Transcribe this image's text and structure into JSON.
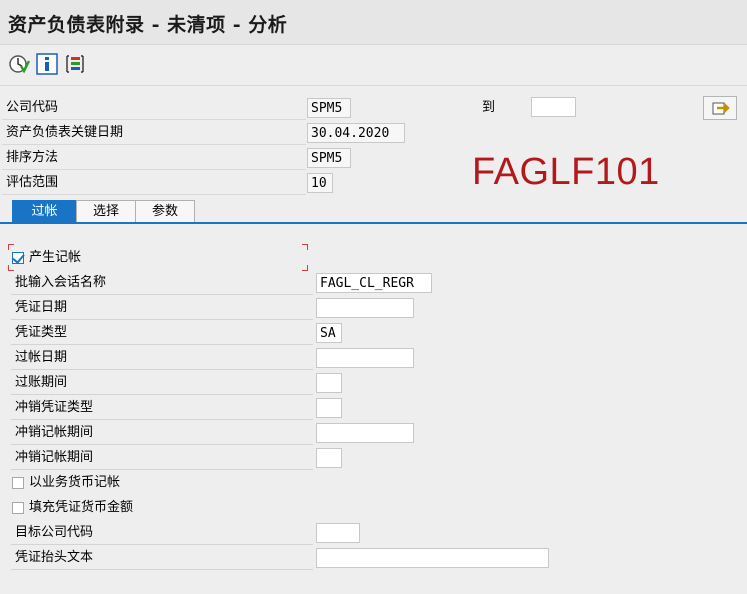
{
  "window": {
    "title": "资产负债表附录 - 未清项 - 分析"
  },
  "toolbar": {
    "execute_icon": "execute-clock-icon",
    "info_icon": "info-icon",
    "variant_icon": "program-variant-icon"
  },
  "header_fields": {
    "company_code_label": "公司代码",
    "company_code_value": "SPM5",
    "to_label": "到",
    "to_value": "",
    "key_date_label": "资产负债表关键日期",
    "key_date_value": "30.04.2020",
    "sort_method_label": "排序方法",
    "sort_method_value": "SPM5",
    "valuation_area_label": "评估范围",
    "valuation_area_value": "10"
  },
  "transaction_code": "FAGLF101",
  "tabs": [
    {
      "label": "过帐",
      "active": true
    },
    {
      "label": "选择",
      "active": false
    },
    {
      "label": "参数",
      "active": false
    }
  ],
  "posting": {
    "generate_postings_label": "产生记帐",
    "generate_postings_checked": true,
    "session_name_label": "批输入会话名称",
    "session_name_value": "FAGL_CL_REGR",
    "doc_date_label": "凭证日期",
    "doc_date_value": "",
    "doc_type_label": "凭证类型",
    "doc_type_value": "SA",
    "posting_date_label": "过帐日期",
    "posting_date_value": "",
    "posting_period_label": "过账期间",
    "posting_period_value": "",
    "reversal_doc_type_label": "冲销凭证类型",
    "reversal_doc_type_value": "",
    "reversal_posting_date_label": "冲销记帐期间",
    "reversal_posting_date_value": "",
    "reversal_posting_period_label": "冲销记帐期间",
    "reversal_posting_period_value": "",
    "tx_currency_label": "以业务货币记帐",
    "tx_currency_checked": false,
    "fill_doc_amount_label": "填充凭证货币金额",
    "fill_doc_amount_checked": false,
    "target_company_label": "目标公司代码",
    "target_company_value": "",
    "header_text_label": "凭证抬头文本",
    "header_text_value": ""
  },
  "colors": {
    "accent": "#1a74c5",
    "tcode": "#b3191b"
  }
}
